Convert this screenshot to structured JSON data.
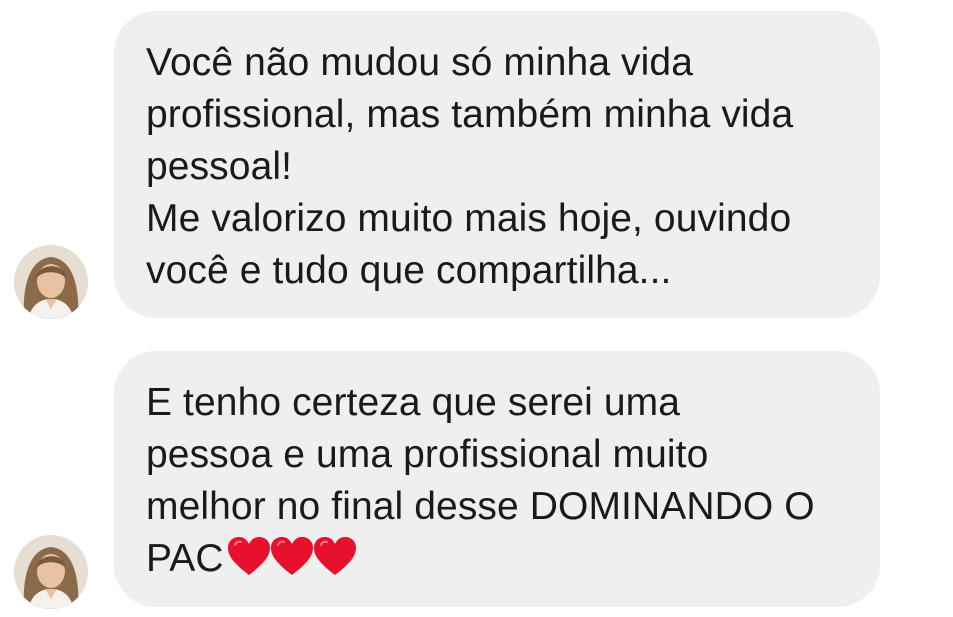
{
  "conversation": {
    "messages": [
      {
        "lines": [
          "Você não mudou só minha vida",
          "profissional, mas também minha vida",
          "pessoal!",
          "Me valorizo muito mais hoje, ouvindo",
          "você e tudo que compartilha..."
        ],
        "avatar_icon": "user-photo-avatar"
      },
      {
        "lines": [
          "E tenho certeza que serei uma",
          "pessoa e uma profissional muito",
          "melhor no final desse DOMINANDO O"
        ],
        "last_line_text": "PAC",
        "last_line_emoji": "❤️❤️❤️",
        "emoji_icons": [
          "heart-icon",
          "heart-icon",
          "heart-icon"
        ],
        "avatar_icon": "user-photo-avatar"
      }
    ]
  },
  "colors": {
    "bubble_background": "#efefef",
    "text": "#1a1a1a",
    "heart": "#e8112d",
    "page_background": "#ffffff"
  }
}
